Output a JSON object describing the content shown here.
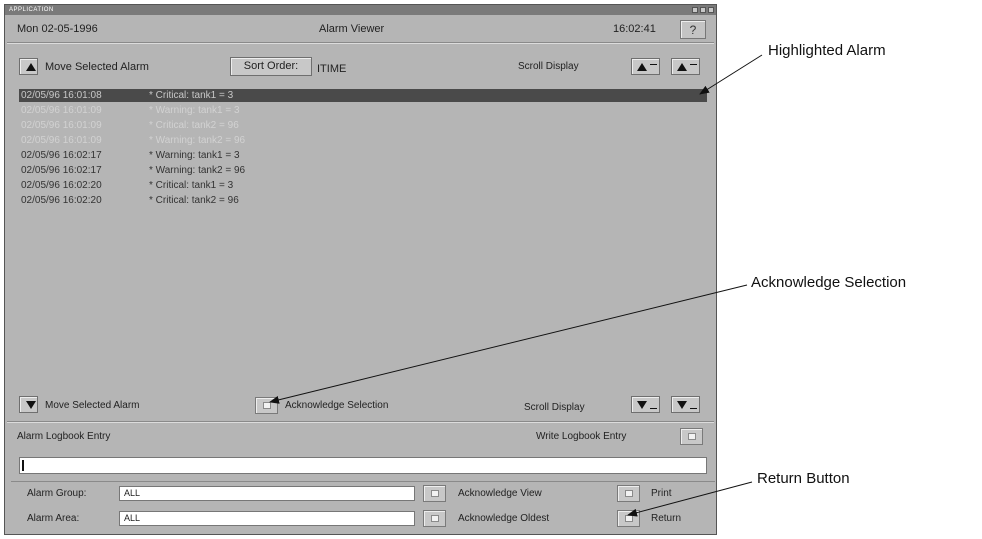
{
  "window": {
    "title": "APPLICATION",
    "date": "Mon 02-05-1996",
    "app_title": "Alarm Viewer",
    "time": "16:02:41",
    "help_label": "?"
  },
  "top_toolbar": {
    "move_selected_label": "Move Selected Alarm",
    "sort_order_label": "Sort Order:",
    "sort_order_value": "ITIME",
    "scroll_display_label": "Scroll Display"
  },
  "alarms": [
    {
      "timestamp": "02/05/96 16:01:08",
      "message": "* Critical: tank1 = 3",
      "state": "sel"
    },
    {
      "timestamp": "02/05/96 16:01:09",
      "message": "* Warning: tank1 = 3",
      "state": "faded"
    },
    {
      "timestamp": "02/05/96 16:01:09",
      "message": "* Critical: tank2 = 96",
      "state": "faded"
    },
    {
      "timestamp": "02/05/96 16:01:09",
      "message": "* Warning: tank2 = 96",
      "state": "faded"
    },
    {
      "timestamp": "02/05/96 16:02:17",
      "message": "* Warning: tank1 = 3",
      "state": "norm"
    },
    {
      "timestamp": "02/05/96 16:02:17",
      "message": "* Warning: tank2 = 96",
      "state": "norm"
    },
    {
      "timestamp": "02/05/96 16:02:20",
      "message": "* Critical: tank1 = 3",
      "state": "norm"
    },
    {
      "timestamp": "02/05/96 16:02:20",
      "message": "* Critical: tank2 = 96",
      "state": "norm"
    }
  ],
  "bottom_toolbar": {
    "move_selected_label": "Move Selected Alarm",
    "acknowledge_selection_label": "Acknowledge Selection",
    "scroll_display_label": "Scroll Display"
  },
  "logbook": {
    "label": "Alarm Logbook Entry",
    "write_label": "Write Logbook Entry",
    "value": ""
  },
  "filters": {
    "group_label": "Alarm Group:",
    "group_value": "ALL",
    "area_label": "Alarm Area:",
    "area_value": "ALL",
    "ack_view_label": "Acknowledge View",
    "ack_oldest_label": "Acknowledge Oldest",
    "print_label": "Print",
    "return_label": "Return"
  },
  "annotations": {
    "highlighted_alarm": "Highlighted Alarm",
    "acknowledge_selection": "Acknowledge Selection",
    "return_button": "Return Button"
  },
  "colors": {
    "window_bg": "#b5b5b5",
    "selected_row_bg": "#4a4a4a"
  }
}
